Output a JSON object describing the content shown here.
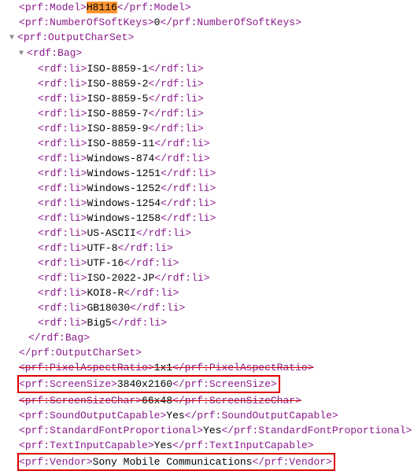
{
  "model_open": "prf:Model",
  "model_value": "H8116",
  "model_close": "prf:Model",
  "softkeys_open": "prf:NumberOfSoftKeys",
  "softkeys_value": "0",
  "softkeys_close": "prf:NumberOfSoftKeys",
  "outputcharset_open": "prf:OutputCharSet",
  "bag_open": "rdf:Bag",
  "charset_items": [
    "ISO-8859-1",
    "ISO-8859-2",
    "ISO-8859-5",
    "ISO-8859-7",
    "ISO-8859-9",
    "ISO-8859-11",
    "Windows-874",
    "Windows-1251",
    "Windows-1252",
    "Windows-1254",
    "Windows-1258",
    "US-ASCII",
    "UTF-8",
    "UTF-16",
    "ISO-2022-JP",
    "KOI8-R",
    "GB18030",
    "Big5"
  ],
  "li_tag": "rdf:li",
  "bag_close": "rdf:Bag",
  "outputcharset_close": "prf:OutputCharSet",
  "par_open": "prf:PixelAspectRatio",
  "par_value": "1x1",
  "par_close": "prf:PixelAspectRatio",
  "screensize_open": "prf:ScreenSize",
  "screensize_value": "3840x2160",
  "screensize_close": "prf:ScreenSize",
  "sschar_open": "prf:ScreenSizeChar",
  "sschar_value": "66x48",
  "sschar_close": "prf:ScreenSizeChar",
  "soc_open": "prf:SoundOutputCapable",
  "soc_value": "Yes",
  "soc_close": "prf:SoundOutputCapable",
  "sfp_open": "prf:StandardFontProportional",
  "sfp_value": "Yes",
  "sfp_close": "prf:StandardFontProportional",
  "tic_open": "prf:TextInputCapable",
  "tic_value": "Yes",
  "tic_close": "prf:TextInputCapable",
  "vendor_open": "prf:Vendor",
  "vendor_value": "Sony Mobile Communications",
  "vendor_close": "prf:Vendor"
}
